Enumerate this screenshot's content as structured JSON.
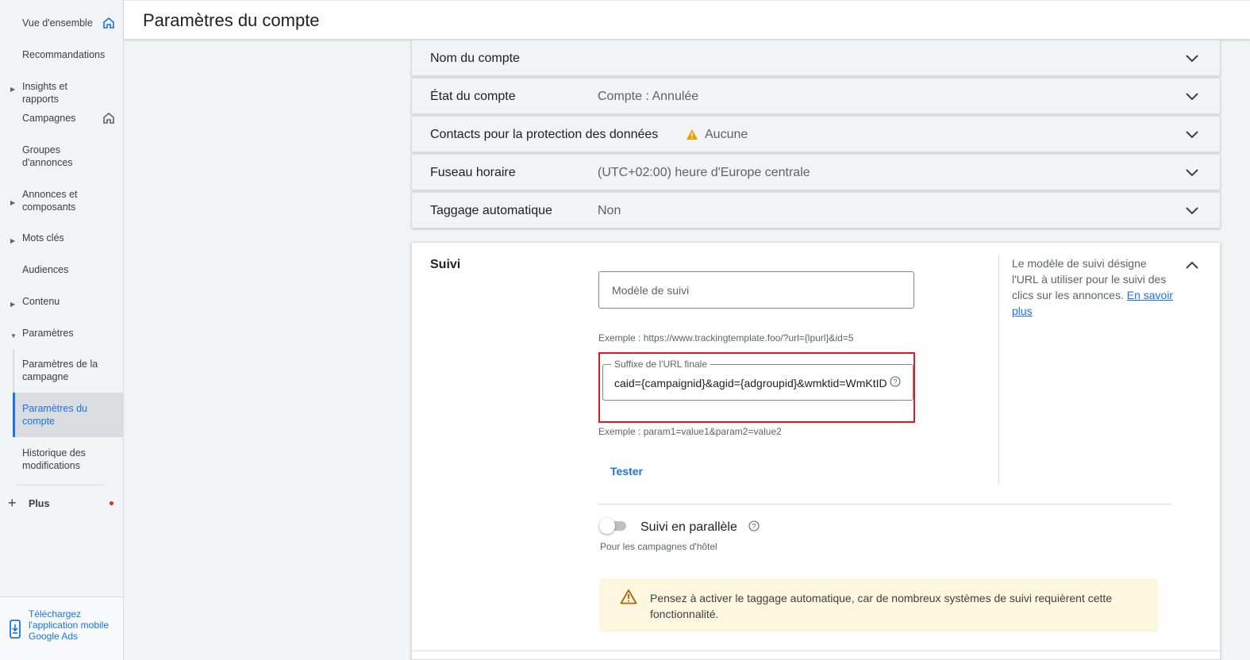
{
  "header": {
    "title": "Paramètres du compte"
  },
  "sidebar": {
    "items": [
      {
        "label": "Vue d'ensemble"
      },
      {
        "label": "Recommandations"
      },
      {
        "label": "Insights et rapports"
      },
      {
        "label": "Campagnes"
      },
      {
        "label": "Groupes d'annonces"
      },
      {
        "label": "Annonces et composants"
      },
      {
        "label": "Mots clés"
      },
      {
        "label": "Audiences"
      },
      {
        "label": "Contenu"
      },
      {
        "label": "Paramètres"
      },
      {
        "label": "Paramètres de la campagne"
      },
      {
        "label": "Paramètres du compte"
      },
      {
        "label": "Historique des modifications"
      }
    ],
    "plus_label": "Plus",
    "app_promo": "Téléchargez l'application mobile Google Ads"
  },
  "settings_rows": [
    {
      "title": "Nom du compte",
      "value": ""
    },
    {
      "title": "État du compte",
      "value": "Compte : Annulée"
    },
    {
      "title": "Contacts pour la protection des données",
      "value": "Aucune"
    },
    {
      "title": "Fuseau horaire",
      "value": "(UTC+02:00) heure d'Europe centrale"
    },
    {
      "title": "Taggage automatique",
      "value": "Non"
    }
  ],
  "tracking": {
    "title": "Suivi",
    "template_placeholder": "Modèle de suivi",
    "template_example": "Exemple : https://www.trackingtemplate.foo/?url={lpurl}&id=5",
    "suffix_label": "Suffixe de l'URL finale",
    "suffix_value": "caid={campaignid}&agid={adgroupid}&wmktid=WmKtID",
    "suffix_example": "Exemple : param1=value1&param2=value2",
    "test_button": "Tester",
    "side_help": "Le modèle de suivi désigne l'URL à utiliser pour le suivi des clics sur les annonces.",
    "learn_more": "En savoir plus",
    "parallel_label": "Suivi en parallèle",
    "parallel_hint": "Pour les campagnes d'hôtel",
    "parallel_enabled": false,
    "warning": "Pensez à activer le taggage automatique, car de nombreux systèmes de suivi requièrent cette fonctionnalité."
  },
  "colors": {
    "accent": "#1a73e8",
    "warning": "#f29900",
    "highlight_border": "#e01a1a",
    "warning_bg": "#fef7e0"
  }
}
